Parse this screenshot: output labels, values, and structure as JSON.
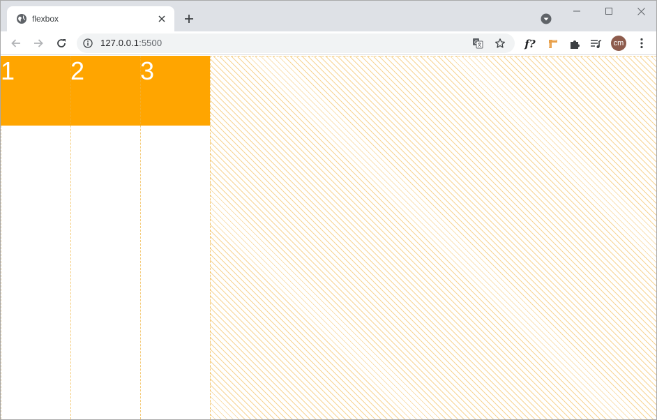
{
  "browser": {
    "tab": {
      "title": "flexbox",
      "favicon": "globe-icon",
      "close": "close-icon"
    },
    "new_tab": "plus-icon",
    "profile_menu": "chevron-down-circle-icon",
    "window_controls": [
      "minimize-icon",
      "maximize-icon",
      "close-icon"
    ],
    "toolbar": {
      "back": "arrow-left-icon",
      "forward": "arrow-right-icon",
      "reload": "reload-icon",
      "site_info": "info-icon",
      "url_host": "127.0.0.1",
      "url_port": ":5500",
      "translate": "translate-icon",
      "bookmark": "star-icon",
      "extensions": [
        {
          "name": "font-ext-icon",
          "label": "f?"
        },
        {
          "name": "ruler-ext-icon"
        },
        {
          "name": "puzzle-icon"
        },
        {
          "name": "media-queue-icon"
        }
      ],
      "avatar_initials": "cm",
      "menu": "more-vert-icon"
    }
  },
  "page": {
    "accent_color": "#ffa500",
    "items": [
      {
        "label": "1"
      },
      {
        "label": "2"
      },
      {
        "label": "3"
      }
    ]
  }
}
